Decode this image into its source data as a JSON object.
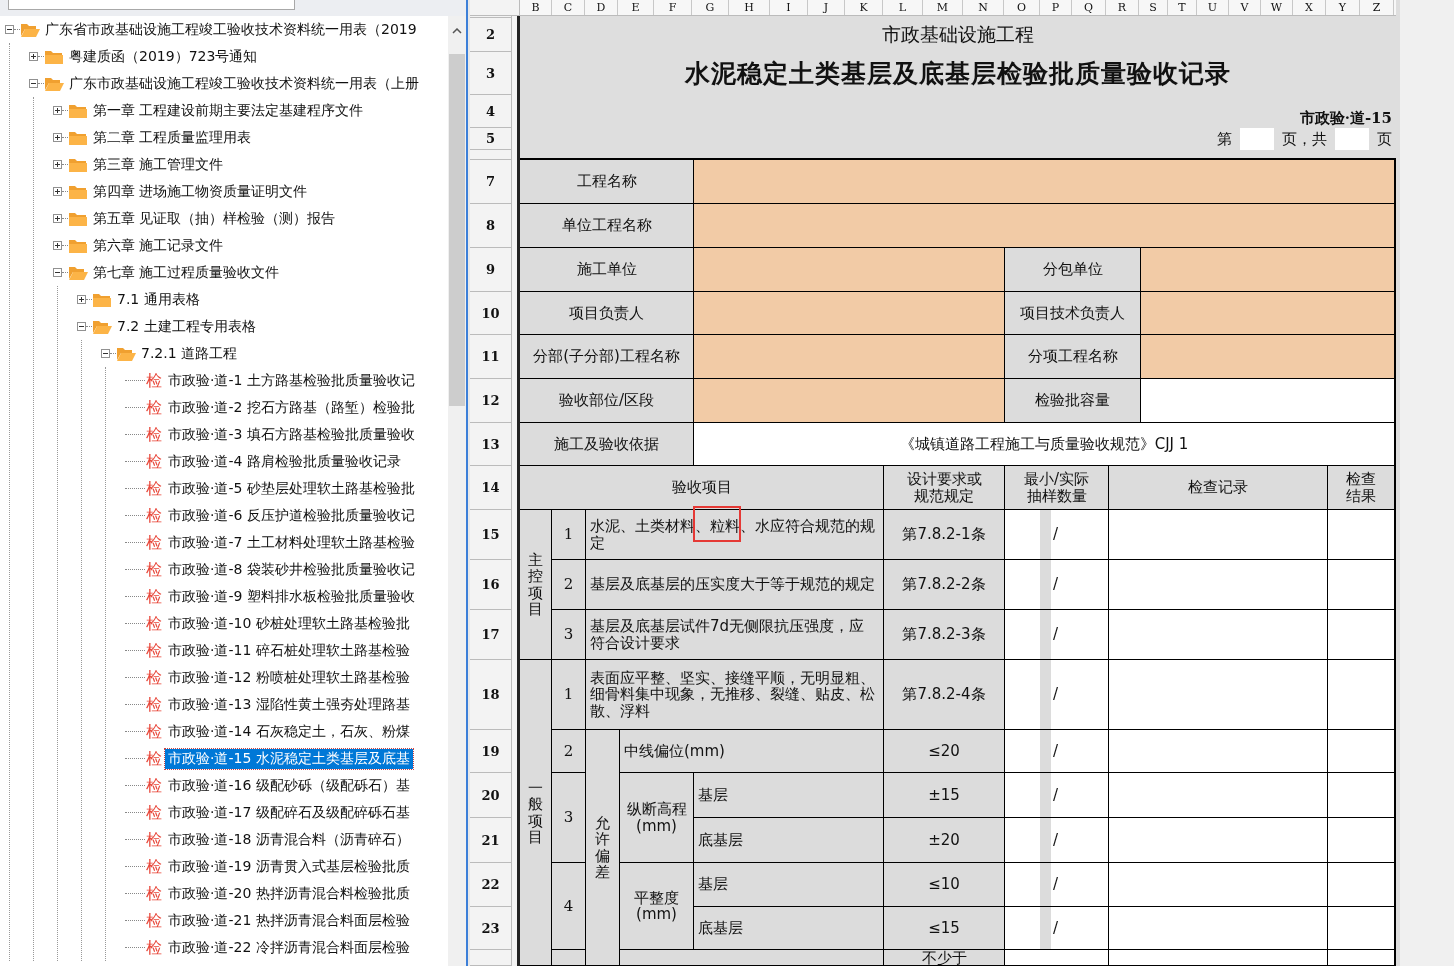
{
  "tree": [
    {
      "kind": "folder",
      "label": "广东省市政基础设施工程竣工验收技术资料统一用表（2019",
      "expanded": true,
      "selected": false,
      "children": [
        {
          "kind": "folder",
          "label": "粤建质函（2019）723号通知",
          "expanded": false,
          "selected": false
        },
        {
          "kind": "folder",
          "label": "广东市政基础设施工程竣工验收技术资料统一用表（上册",
          "expanded": true,
          "selected": false,
          "children": [
            {
              "kind": "folder",
              "label": "第一章 工程建设前期主要法定基建程序文件",
              "expanded": false,
              "selected": false
            },
            {
              "kind": "folder",
              "label": "第二章 工程质量监理用表",
              "expanded": false,
              "selected": false
            },
            {
              "kind": "folder",
              "label": "第三章 施工管理文件",
              "expanded": false,
              "selected": false
            },
            {
              "kind": "folder",
              "label": "第四章 进场施工物资质量证明文件",
              "expanded": false,
              "selected": false
            },
            {
              "kind": "folder",
              "label": "第五章 见证取（抽）样检验（测）报告",
              "expanded": false,
              "selected": false
            },
            {
              "kind": "folder",
              "label": "第六章 施工记录文件",
              "expanded": false,
              "selected": false
            },
            {
              "kind": "folder",
              "label": "第七章 施工过程质量验收文件",
              "expanded": true,
              "selected": false,
              "children": [
                {
                  "kind": "folder",
                  "label": "7.1 通用表格",
                  "expanded": false,
                  "selected": false
                },
                {
                  "kind": "folder",
                  "label": "7.2 土建工程专用表格",
                  "expanded": true,
                  "selected": false,
                  "children": [
                    {
                      "kind": "folder",
                      "label": "7.2.1 道路工程",
                      "expanded": true,
                      "selected": false,
                      "children": [
                        {
                          "kind": "form",
                          "badge": "检",
                          "label": "市政验·道-1 土方路基检验批质量验收记",
                          "selected": false
                        },
                        {
                          "kind": "form",
                          "badge": "检",
                          "label": "市政验·道-2 挖石方路基（路堑）检验批",
                          "selected": false
                        },
                        {
                          "kind": "form",
                          "badge": "检",
                          "label": "市政验·道-3 填石方路基检验批质量验收",
                          "selected": false
                        },
                        {
                          "kind": "form",
                          "badge": "检",
                          "label": "市政验·道-4 路肩检验批质量验收记录",
                          "selected": false
                        },
                        {
                          "kind": "form",
                          "badge": "检",
                          "label": "市政验·道-5 砂垫层处理软土路基检验批",
                          "selected": false
                        },
                        {
                          "kind": "form",
                          "badge": "检",
                          "label": "市政验·道-6 反压护道检验批质量验收记",
                          "selected": false
                        },
                        {
                          "kind": "form",
                          "badge": "检",
                          "label": "市政验·道-7 土工材料处理软土路基检验",
                          "selected": false
                        },
                        {
                          "kind": "form",
                          "badge": "检",
                          "label": "市政验·道-8 袋装砂井检验批质量验收记",
                          "selected": false
                        },
                        {
                          "kind": "form",
                          "badge": "检",
                          "label": "市政验·道-9 塑料排水板检验批质量验收",
                          "selected": false
                        },
                        {
                          "kind": "form",
                          "badge": "检",
                          "label": "市政验·道-10 砂桩处理软土路基检验批",
                          "selected": false
                        },
                        {
                          "kind": "form",
                          "badge": "检",
                          "label": "市政验·道-11 碎石桩处理软土路基检验",
                          "selected": false
                        },
                        {
                          "kind": "form",
                          "badge": "检",
                          "label": "市政验·道-12 粉喷桩处理软土路基检验",
                          "selected": false
                        },
                        {
                          "kind": "form",
                          "badge": "检",
                          "label": "市政验·道-13 湿陷性黄土强夯处理路基",
                          "selected": false
                        },
                        {
                          "kind": "form",
                          "badge": "检",
                          "label": "市政验·道-14 石灰稳定土，石灰、粉煤",
                          "selected": false
                        },
                        {
                          "kind": "form",
                          "badge": "检",
                          "label": "市政验·道-15 水泥稳定土类基层及底基",
                          "selected": true
                        },
                        {
                          "kind": "form",
                          "badge": "检",
                          "label": "市政验·道-16 级配砂砾（级配砾石）基",
                          "selected": false
                        },
                        {
                          "kind": "form",
                          "badge": "检",
                          "label": "市政验·道-17 级配碎石及级配碎砾石基",
                          "selected": false
                        },
                        {
                          "kind": "form",
                          "badge": "检",
                          "label": "市政验·道-18 沥青混合料（沥青碎石）",
                          "selected": false
                        },
                        {
                          "kind": "form",
                          "badge": "检",
                          "label": "市政验·道-19 沥青贯入式基层检验批质",
                          "selected": false
                        },
                        {
                          "kind": "form",
                          "badge": "检",
                          "label": "市政验·道-20 热拌沥青混合料检验批质",
                          "selected": false
                        },
                        {
                          "kind": "form",
                          "badge": "检",
                          "label": "市政验·道-21 热拌沥青混合料面层检验",
                          "selected": false
                        },
                        {
                          "kind": "form",
                          "badge": "检",
                          "label": "市政验·道-22 冷拌沥青混合料面层检验",
                          "selected": false
                        }
                      ]
                    }
                  ]
                }
              ]
            }
          ]
        }
      ]
    }
  ],
  "sheet": {
    "columns": [
      "B",
      "C",
      "D",
      "E",
      "F",
      "G",
      "H",
      "I",
      "J",
      "K",
      "L",
      "M",
      "N",
      "O",
      "P",
      "Q",
      "R",
      "S",
      "T",
      "U",
      "V",
      "W",
      "X",
      "Y",
      "Z"
    ],
    "row_numbers": [
      "2",
      "3",
      "4",
      "5",
      "7",
      "8",
      "9",
      "10",
      "11",
      "12",
      "13",
      "14",
      "15",
      "16",
      "17",
      "18",
      "19",
      "20",
      "21",
      "22",
      "23"
    ],
    "subtitle": "市政基础设施工程",
    "title": "水泥稳定土类基层及底基层检验批质量验收记录",
    "code": "市政验·道-15",
    "page": {
      "prefix": "第",
      "middle": "页，共",
      "suffix": "页"
    },
    "info": [
      {
        "label": "工程名称",
        "editable": true
      },
      {
        "label": "单位工程名称",
        "editable": true
      },
      {
        "label": "施工单位",
        "editable": true,
        "label2": "分包单位",
        "editable2": true
      },
      {
        "label": "项目负责人",
        "editable": true,
        "label2": "项目技术负责人",
        "editable2": true
      },
      {
        "label": "分部(子分部)工程名称",
        "editable": true,
        "label2": "分项工程名称",
        "editable2": true
      },
      {
        "label": "验收部位/区段",
        "editable": true,
        "label2": "检验批容量",
        "editable2": false
      },
      {
        "label": "施工及验收依据",
        "editable": false,
        "value": "《城镇道路工程施工与质量验收规范》CJJ 1"
      }
    ],
    "headings": [
      "验收项目",
      "设计要求或规范规定",
      "最小/实际抽样数量",
      "检查记录",
      "检查结果"
    ],
    "main_group": {
      "label": "主控项目",
      "items": [
        {
          "no": "1",
          "desc": "水泥、土类材料、粒料、水应符合规范的规定",
          "spec": "第7.8.2-1条",
          "sample": "/",
          "marked": true
        },
        {
          "no": "2",
          "desc": "基层及底基层的压实度大于等于规范的规定",
          "spec": "第7.8.2-2条",
          "sample": "/",
          "marked": false
        },
        {
          "no": "3",
          "desc": "基层及底基层试件7d无侧限抗压强度，应符合设计要求",
          "spec": "第7.8.2-3条",
          "sample": "/",
          "marked": false
        }
      ]
    },
    "general_group": {
      "label": "一般项目",
      "deviation_label": "允许偏差",
      "items": [
        {
          "kind": "text",
          "no": "1",
          "desc": "表面应平整、坚实、接缝平顺，无明显粗、细骨料集中现象，无推移、裂缝、贴皮、松散、浮料",
          "spec": "第7.8.2-4条",
          "sample": "/"
        },
        {
          "kind": "single",
          "no": "2",
          "name": "中线偏位(mm)",
          "spec": "≤20",
          "sample": "/"
        },
        {
          "kind": "split",
          "no": "3",
          "name": "纵断高程\n(mm)",
          "parts": [
            {
              "name": "基层",
              "spec": "±15",
              "sample": "/"
            },
            {
              "name": "底基层",
              "spec": "±20",
              "sample": "/"
            }
          ]
        },
        {
          "kind": "split",
          "no": "4",
          "name": "平整度\n(mm)",
          "parts": [
            {
              "name": "基层",
              "spec": "≤10",
              "sample": "/"
            },
            {
              "name": "底基层",
              "spec": "≤15",
              "sample": "/"
            }
          ]
        },
        {
          "kind": "partial",
          "spec": "不少于"
        }
      ]
    }
  }
}
